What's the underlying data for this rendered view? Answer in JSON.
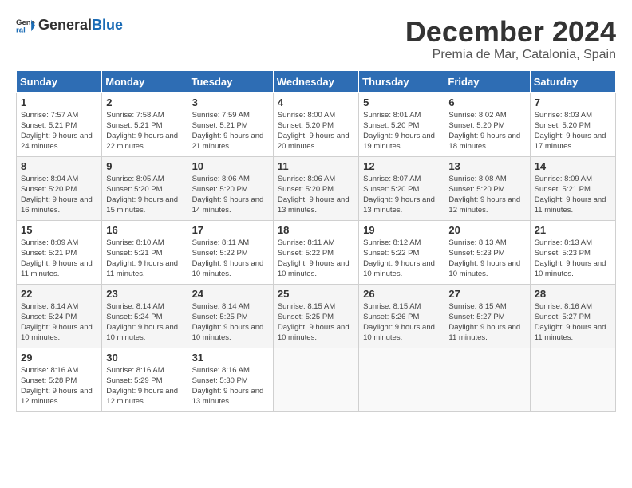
{
  "logo": {
    "general": "General",
    "blue": "Blue"
  },
  "title": "December 2024",
  "subtitle": "Premia de Mar, Catalonia, Spain",
  "columns": [
    "Sunday",
    "Monday",
    "Tuesday",
    "Wednesday",
    "Thursday",
    "Friday",
    "Saturday"
  ],
  "weeks": [
    [
      {
        "day": "1",
        "sunrise": "7:57 AM",
        "sunset": "5:21 PM",
        "daylight": "9 hours and 24 minutes."
      },
      {
        "day": "2",
        "sunrise": "7:58 AM",
        "sunset": "5:21 PM",
        "daylight": "9 hours and 22 minutes."
      },
      {
        "day": "3",
        "sunrise": "7:59 AM",
        "sunset": "5:21 PM",
        "daylight": "9 hours and 21 minutes."
      },
      {
        "day": "4",
        "sunrise": "8:00 AM",
        "sunset": "5:20 PM",
        "daylight": "9 hours and 20 minutes."
      },
      {
        "day": "5",
        "sunrise": "8:01 AM",
        "sunset": "5:20 PM",
        "daylight": "9 hours and 19 minutes."
      },
      {
        "day": "6",
        "sunrise": "8:02 AM",
        "sunset": "5:20 PM",
        "daylight": "9 hours and 18 minutes."
      },
      {
        "day": "7",
        "sunrise": "8:03 AM",
        "sunset": "5:20 PM",
        "daylight": "9 hours and 17 minutes."
      }
    ],
    [
      {
        "day": "8",
        "sunrise": "8:04 AM",
        "sunset": "5:20 PM",
        "daylight": "9 hours and 16 minutes."
      },
      {
        "day": "9",
        "sunrise": "8:05 AM",
        "sunset": "5:20 PM",
        "daylight": "9 hours and 15 minutes."
      },
      {
        "day": "10",
        "sunrise": "8:06 AM",
        "sunset": "5:20 PM",
        "daylight": "9 hours and 14 minutes."
      },
      {
        "day": "11",
        "sunrise": "8:06 AM",
        "sunset": "5:20 PM",
        "daylight": "9 hours and 13 minutes."
      },
      {
        "day": "12",
        "sunrise": "8:07 AM",
        "sunset": "5:20 PM",
        "daylight": "9 hours and 13 minutes."
      },
      {
        "day": "13",
        "sunrise": "8:08 AM",
        "sunset": "5:20 PM",
        "daylight": "9 hours and 12 minutes."
      },
      {
        "day": "14",
        "sunrise": "8:09 AM",
        "sunset": "5:21 PM",
        "daylight": "9 hours and 11 minutes."
      }
    ],
    [
      {
        "day": "15",
        "sunrise": "8:09 AM",
        "sunset": "5:21 PM",
        "daylight": "9 hours and 11 minutes."
      },
      {
        "day": "16",
        "sunrise": "8:10 AM",
        "sunset": "5:21 PM",
        "daylight": "9 hours and 11 minutes."
      },
      {
        "day": "17",
        "sunrise": "8:11 AM",
        "sunset": "5:22 PM",
        "daylight": "9 hours and 10 minutes."
      },
      {
        "day": "18",
        "sunrise": "8:11 AM",
        "sunset": "5:22 PM",
        "daylight": "9 hours and 10 minutes."
      },
      {
        "day": "19",
        "sunrise": "8:12 AM",
        "sunset": "5:22 PM",
        "daylight": "9 hours and 10 minutes."
      },
      {
        "day": "20",
        "sunrise": "8:13 AM",
        "sunset": "5:23 PM",
        "daylight": "9 hours and 10 minutes."
      },
      {
        "day": "21",
        "sunrise": "8:13 AM",
        "sunset": "5:23 PM",
        "daylight": "9 hours and 10 minutes."
      }
    ],
    [
      {
        "day": "22",
        "sunrise": "8:14 AM",
        "sunset": "5:24 PM",
        "daylight": "9 hours and 10 minutes."
      },
      {
        "day": "23",
        "sunrise": "8:14 AM",
        "sunset": "5:24 PM",
        "daylight": "9 hours and 10 minutes."
      },
      {
        "day": "24",
        "sunrise": "8:14 AM",
        "sunset": "5:25 PM",
        "daylight": "9 hours and 10 minutes."
      },
      {
        "day": "25",
        "sunrise": "8:15 AM",
        "sunset": "5:25 PM",
        "daylight": "9 hours and 10 minutes."
      },
      {
        "day": "26",
        "sunrise": "8:15 AM",
        "sunset": "5:26 PM",
        "daylight": "9 hours and 10 minutes."
      },
      {
        "day": "27",
        "sunrise": "8:15 AM",
        "sunset": "5:27 PM",
        "daylight": "9 hours and 11 minutes."
      },
      {
        "day": "28",
        "sunrise": "8:16 AM",
        "sunset": "5:27 PM",
        "daylight": "9 hours and 11 minutes."
      }
    ],
    [
      {
        "day": "29",
        "sunrise": "8:16 AM",
        "sunset": "5:28 PM",
        "daylight": "9 hours and 12 minutes."
      },
      {
        "day": "30",
        "sunrise": "8:16 AM",
        "sunset": "5:29 PM",
        "daylight": "9 hours and 12 minutes."
      },
      {
        "day": "31",
        "sunrise": "8:16 AM",
        "sunset": "5:30 PM",
        "daylight": "9 hours and 13 minutes."
      },
      null,
      null,
      null,
      null
    ]
  ],
  "labels": {
    "sunrise": "Sunrise:",
    "sunset": "Sunset:",
    "daylight": "Daylight:"
  }
}
